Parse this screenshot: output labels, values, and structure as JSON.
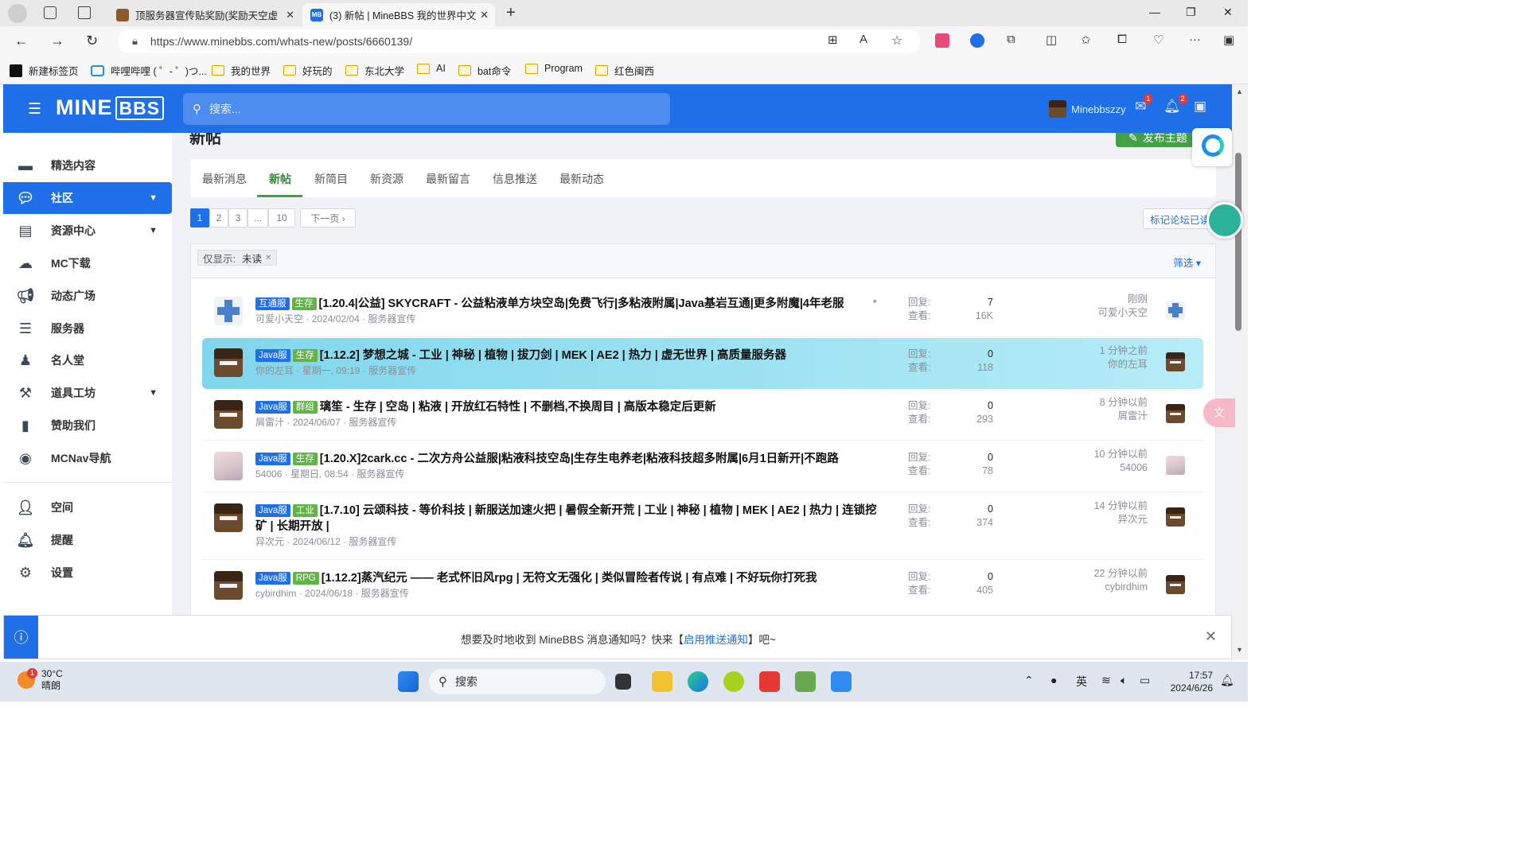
{
  "browser": {
    "tabs": [
      {
        "label": "顶服务器宣传贴奖励(奖励天空虚",
        "active": false
      },
      {
        "label": "(3) 新帖 | MineBBS 我的世界中文",
        "active": true
      }
    ],
    "favicon_text": "MB",
    "url": "https://www.minebbs.com/whats-new/posts/6660139/",
    "bookmarks": [
      "新建标签页",
      "哔哩哔哩 ( ゜- ゜)つ...",
      "我的世界",
      "好玩的",
      "东北大学",
      "AI",
      "bat命令",
      "Program",
      "红色闽西"
    ]
  },
  "site": {
    "logo_main": "MINE",
    "logo_bbs": "BBS",
    "search_placeholder": "搜索...",
    "username": "Minebbszzy",
    "mail_badge": "1",
    "alert_badge": "2",
    "accent": "#1f6fe8"
  },
  "sidebar": {
    "items": [
      {
        "label": "精选内容",
        "icon": "folder-icon"
      },
      {
        "label": "社区",
        "icon": "chat-icon",
        "active": true
      },
      {
        "label": "资源中心",
        "icon": "resource-icon"
      },
      {
        "label": "MC下载",
        "icon": "cloud-download-icon"
      },
      {
        "label": "动态广场",
        "icon": "megaphone-icon"
      },
      {
        "label": "服务器",
        "icon": "server-icon"
      },
      {
        "label": "名人堂",
        "icon": "user-tie-icon"
      },
      {
        "label": "道具工坊",
        "icon": "tools-icon"
      },
      {
        "label": "赞助我们",
        "icon": "battery-icon"
      },
      {
        "label": "MCNav导航",
        "icon": "compass-icon"
      },
      {
        "label": "空间",
        "icon": "person-icon"
      },
      {
        "label": "提醒",
        "icon": "bell-icon"
      },
      {
        "label": "设置",
        "icon": "gear-icon"
      }
    ]
  },
  "main": {
    "page_title": "新帖",
    "new_thread_label": "发布主题",
    "tabs": [
      "最新消息",
      "新帖",
      "新简目",
      "新资源",
      "最新留言",
      "信息推送",
      "最新动态"
    ],
    "active_tab": "新帖",
    "pagination": [
      "1",
      "2",
      "3",
      "...",
      "10"
    ],
    "next_label": "下一页 ›",
    "mark_read_label": "标记论坛已读",
    "filter_label": "仅显示:",
    "filter_value": "未读",
    "filter_button": "筛选 ▾",
    "reply_label": "回复:",
    "view_label": "查看:"
  },
  "threads": [
    {
      "labels": [
        [
          "互通服",
          "blue"
        ],
        [
          "生存",
          "green"
        ]
      ],
      "title": "[1.20.4|公益] SKYCRAFT - 公益粘液单方块空岛|免费飞行|多粘液附属|Java基岩互通|更多附魔|4年老服",
      "author": "可爱小天空",
      "date": "2024/02/04",
      "section": "服务器宣传",
      "replies": "7",
      "views": "16K",
      "last_time": "刚刚",
      "last_user": "可爱小天空",
      "avatar": "cross"
    },
    {
      "labels": [
        [
          "Java服",
          "blue"
        ],
        [
          "生存",
          "green"
        ]
      ],
      "title": "[1.12.2] 梦想之城 - 工业 | 神秘 | 植物 | 拔刀剑 | MEK | AE2 | 热力 | 虚无世界 | 高质量服务器",
      "author": "你的左耳",
      "date": "星期一, 09:19",
      "section": "服务器宣传",
      "replies": "0",
      "views": "118",
      "last_time": "1 分钟之前",
      "last_user": "你的左耳",
      "avatar": "steve",
      "highlight": true
    },
    {
      "labels": [
        [
          "Java服",
          "blue"
        ],
        [
          "群组",
          "green"
        ]
      ],
      "title": "璃笙 - 生存 | 空岛 | 粘液 | 开放红石特性 | 不删档,不换周目 | 高版本稳定后更新",
      "author": "屑雷汁",
      "date": "2024/06/07",
      "section": "服务器宣传",
      "replies": "0",
      "views": "293",
      "last_time": "8 分钟以前",
      "last_user": "屑雷汁",
      "avatar": "steve"
    },
    {
      "labels": [
        [
          "Java服",
          "blue"
        ],
        [
          "生存",
          "green"
        ]
      ],
      "title": "[1.20.X]2cark.cc - 二次方舟公益服|粘液科技空岛|生存生电养老|粘液科技超多附属|6月1日新开|不跑路",
      "author": "54006",
      "date": "星期日, 08:54",
      "section": "服务器宣传",
      "replies": "0",
      "views": "78",
      "last_time": "10 分钟以前",
      "last_user": "54006",
      "avatar": "anime"
    },
    {
      "labels": [
        [
          "Java服",
          "blue"
        ],
        [
          "工业",
          "green"
        ]
      ],
      "title": "[1.7.10] 云颂科技 - 等价科技 | 新服送加速火把 | 暑假全新开荒 | 工业 | 神秘 | 植物 | MEK | AE2 | 热力 | 连锁挖矿 | 长期开放 |",
      "author": "异次元",
      "date": "2024/06/12",
      "section": "服务器宣传",
      "replies": "0",
      "views": "374",
      "last_time": "14 分钟以前",
      "last_user": "异次元",
      "avatar": "steve"
    },
    {
      "labels": [
        [
          "Java服",
          "blue"
        ],
        [
          "RPG",
          "green"
        ]
      ],
      "title": "[1.12.2]蒸汽纪元 —— 老式怀旧风rpg | 无符文无强化 | 类似冒险者传说 | 有点难 | 不好玩你打死我",
      "author": "cybirdhim",
      "date": "2024/06/18",
      "section": "服务器宣传",
      "replies": "0",
      "views": "405",
      "last_time": "22 分钟以前",
      "last_user": "cybirdhim",
      "avatar": "steve"
    }
  ],
  "notify": {
    "prefix": "想要及时地收到 MineBBS 消息通知吗？快来【",
    "link": "启用推送通知",
    "suffix": "】吧~"
  },
  "taskbar": {
    "temp": "30°C",
    "weather": "晴朗",
    "weather_badge": "1",
    "search_label": "搜索",
    "ime": "英",
    "time": "17:57",
    "date": "2024/6/26"
  }
}
